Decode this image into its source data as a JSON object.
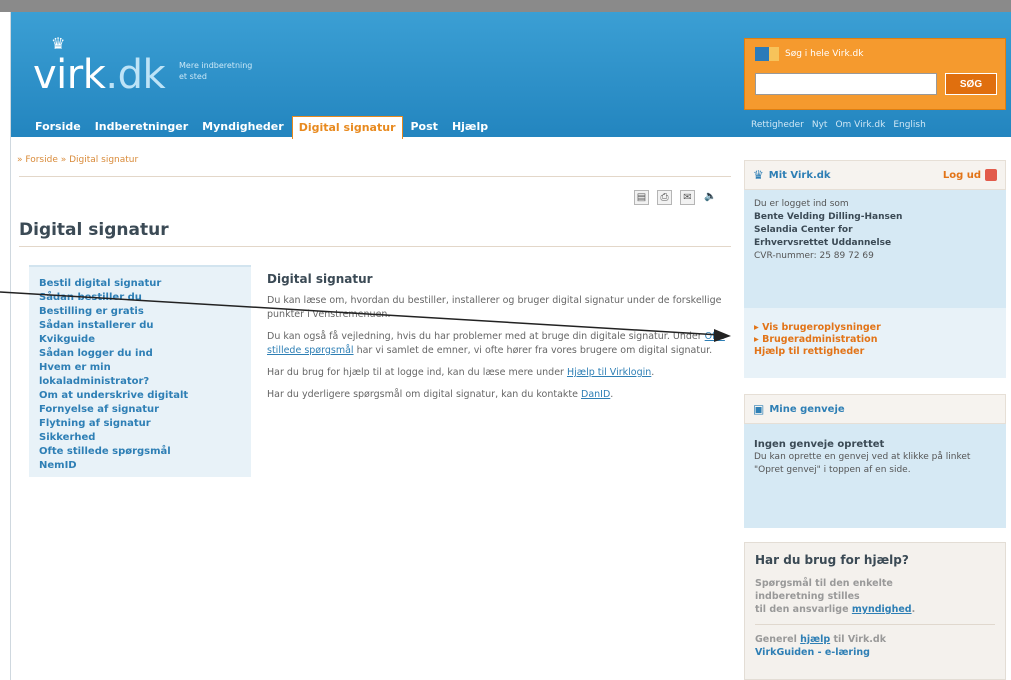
{
  "header": {
    "logo_main": "virk",
    "logo_dot": ".dk",
    "tagline_1": "Mere indberetning",
    "tagline_2": "et sted",
    "nav": [
      "Forside",
      "Indberetninger",
      "Myndigheder",
      "Digital signatur",
      "Post",
      "Hjælp"
    ],
    "active_nav": "Digital signatur",
    "search": {
      "label": "Søg i hele Virk.dk",
      "value": "",
      "button": "SØG"
    },
    "util_nav": [
      "Rettigheder",
      "Nyt",
      "Om Virk.dk",
      "English"
    ]
  },
  "breadcrumb": "» Forside » Digital signatur",
  "page_title": "Digital signatur",
  "subnav": [
    "Bestil digital signatur",
    "Sådan bestiller du",
    "Bestilling er gratis",
    "Sådan installerer du",
    "Kvikguide",
    "Sådan logger du ind",
    "Hvem er min",
    "lokaladministrator?",
    "Om at underskrive digitalt",
    "Fornyelse af signatur",
    "Flytning af signatur",
    "Sikkerhed",
    "Ofte stillede spørgsmål",
    "NemID"
  ],
  "content": {
    "heading": "Digital signatur",
    "p1": "Du kan læse om, hvordan du bestiller, installerer og bruger digital signatur under de forskellige punkter i venstremenuen.",
    "p2_a": "Du kan også få vejledning, hvis du har problemer med at bruge din digitale signatur. Under ",
    "p2_link": "Ofte stillede spørgsmål",
    "p2_b": " har vi samlet de emner, vi ofte hører fra vores brugere om digital signatur.",
    "p3_a": "Har du brug for hjælp til at logge ind, kan du læse mere under ",
    "p3_link": "Hjælp til Virklogin",
    "p3_b": ".",
    "p4_a": "Har du yderligere spørgsmål om digital signatur, kan du kontakte ",
    "p4_link": "DanID",
    "p4_b": "."
  },
  "mitvirk": {
    "title": "Mit Virk.dk",
    "logout": "Log ud",
    "logged_in_as": "Du er logget ind som",
    "user_name": "Bente Velding Dilling-Hansen",
    "org_1": "Selandia Center for",
    "org_2": "Erhvervsrettet Uddannelse",
    "cvr": "CVR-nummer: 25 89 72 69",
    "links": [
      "Vis brugeroplysninger",
      "Brugeradministration",
      "Hjælp til rettigheder"
    ]
  },
  "genveje": {
    "title": "Mine genveje",
    "empty_title": "Ingen genveje oprettet",
    "empty_text": "Du kan oprette en genvej ved at klikke på linket \"Opret genvej\" i toppen af en side."
  },
  "help": {
    "title": "Har du brug for hjælp?",
    "text_1": "Spørgsmål til den enkelte",
    "text_2": "indberetning stilles",
    "text_3": "til den ansvarlige ",
    "text_link": "myndighed",
    "text_end": ".",
    "general_a": "Generel ",
    "general_link": "hjælp",
    "general_b": " til Virk.dk",
    "guide": "VirkGuiden - e-læring"
  }
}
